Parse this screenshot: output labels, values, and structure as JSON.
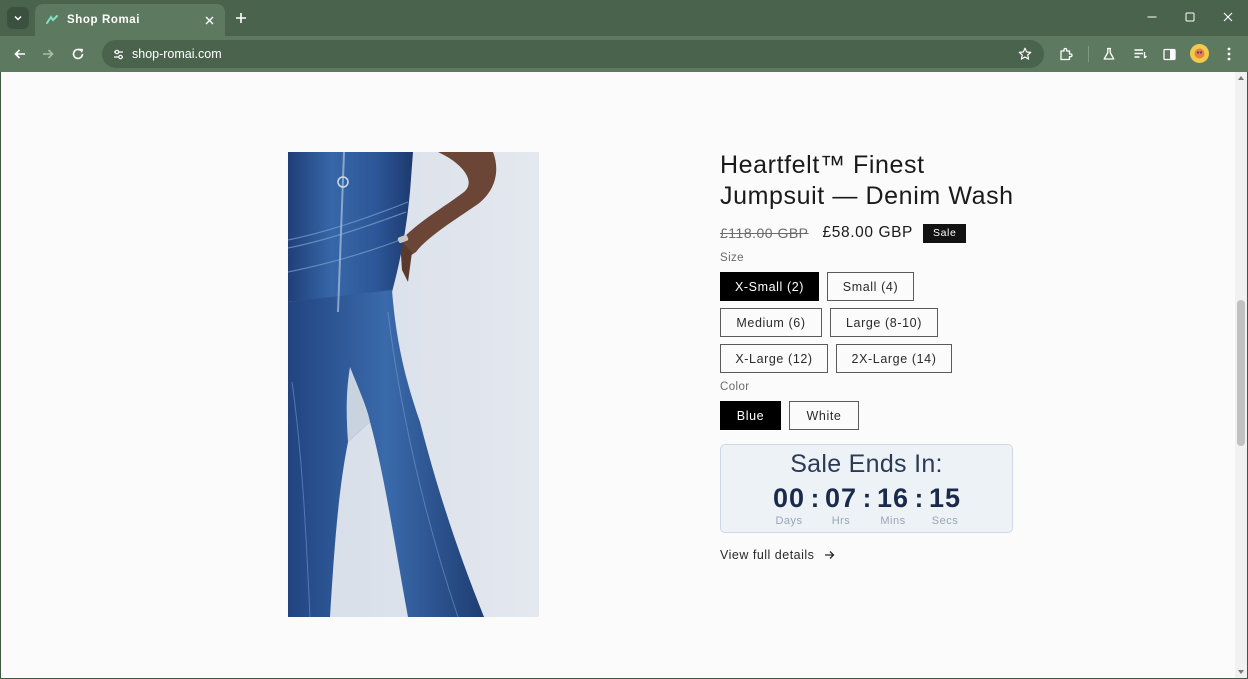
{
  "browser": {
    "tab_title": "Shop Romai",
    "url": "shop-romai.com",
    "icons": [
      "tab-search-icon",
      "close-icon",
      "plus-icon",
      "minimize-icon",
      "maximize-icon",
      "close-window-icon",
      "back-icon",
      "forward-icon",
      "reload-icon",
      "site-info-icon",
      "star-icon",
      "extensions-icon",
      "labs-icon",
      "reading-list-icon",
      "side-panel-icon",
      "profile-avatar",
      "menu-icon"
    ]
  },
  "product": {
    "title": "Heartfelt™ Finest Jumpsuit — Denim Wash",
    "price_old": "£118.00 GBP",
    "price_new": "£58.00 GBP",
    "badge": "Sale",
    "size_label": "Size",
    "sizes": [
      "X-Small (2)",
      "Small (4)",
      "Medium (6)",
      "Large (8-10)",
      "X-Large (12)",
      "2X-Large (14)"
    ],
    "selected_size": "X-Small (2)",
    "color_label": "Color",
    "colors": [
      "Blue",
      "White"
    ],
    "selected_color": "Blue",
    "countdown": {
      "title": "Sale Ends In:",
      "days": "00",
      "hrs": "07",
      "mins": "16",
      "secs": "15",
      "days_label": "Days",
      "hrs_label": "Hrs",
      "mins_label": "Mins",
      "secs_label": "Secs",
      "separator": ":"
    },
    "details_link": "View full details"
  },
  "colors": {
    "chrome_bg": "#4a634d",
    "toolbar_bg": "#5d7a61",
    "page_bg": "#fbfbfb",
    "accent_black": "#000000",
    "countdown_bg": "#edf2f7",
    "countdown_text": "#1b2a4a"
  }
}
